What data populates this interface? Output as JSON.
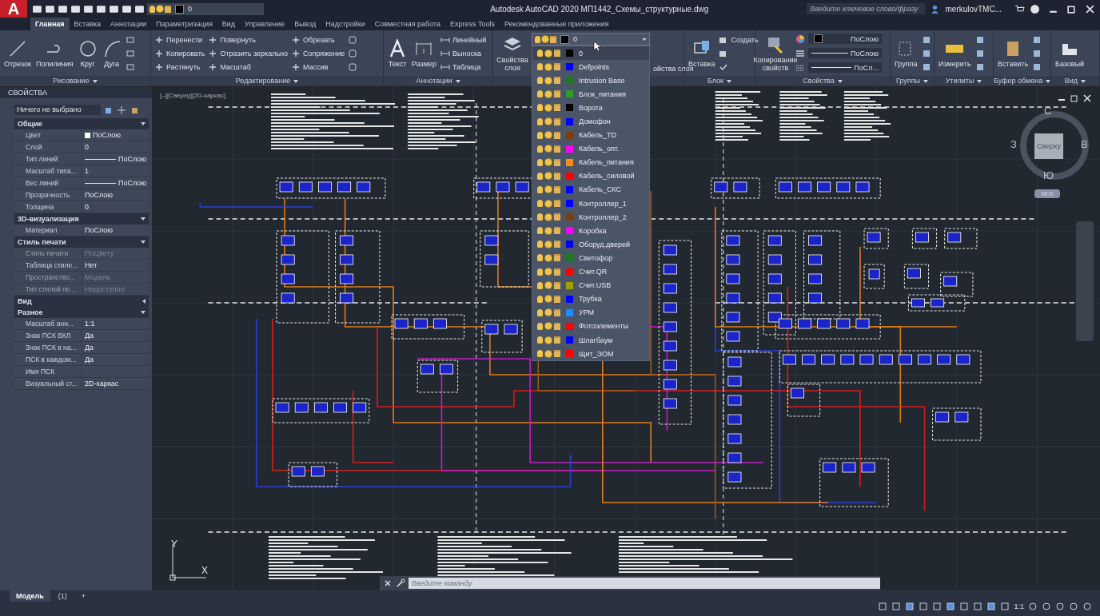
{
  "title_bar": {
    "app_button": "A",
    "layer_value": "0",
    "title": "Autodesk AutoCAD 2020  МП1442_Схемы_структурные.dwg",
    "search_placeholder": "Введите ключевое слово/фразу",
    "user": "merkulovTMC..."
  },
  "tabs": [
    {
      "label": "Главная",
      "selected": true
    },
    {
      "label": "Вставка",
      "selected": false
    },
    {
      "label": "Аннотации",
      "selected": false
    },
    {
      "label": "Параметризация",
      "selected": false
    },
    {
      "label": "Вид",
      "selected": false
    },
    {
      "label": "Управление",
      "selected": false
    },
    {
      "label": "Вывод",
      "selected": false
    },
    {
      "label": "Надстройки",
      "selected": false
    },
    {
      "label": "Совместная работа",
      "selected": false
    },
    {
      "label": "Express Tools",
      "selected": false
    },
    {
      "label": "Рекомендованные приложения",
      "selected": false
    }
  ],
  "ribbon": [
    {
      "kind": "draw",
      "title": "Рисование",
      "large": [
        "Отрезок",
        "Полилиния",
        "Круг",
        "Дуга"
      ]
    },
    {
      "kind": "modify",
      "title": "Редактирование",
      "columns": [
        [
          "Перенести",
          "Копировать",
          "Растянуть"
        ],
        [
          "Повернуть",
          "Отразить зеркально",
          "Масштаб"
        ],
        [
          "Обрезать",
          "Сопряжение",
          "Массив"
        ]
      ]
    },
    {
      "kind": "annotate",
      "title": "Аннотации",
      "large": [
        "Текст",
        "Размер"
      ],
      "small": [
        "Линейный",
        "Выноска",
        "Таблица"
      ]
    },
    {
      "kind": "layers",
      "large": [
        "Свойства слоя"
      ],
      "combo_value": "0",
      "partial_label": "ойства слоя"
    },
    {
      "kind": "block",
      "title": "Блок",
      "large": [
        "Вставка"
      ],
      "small": [
        "Создать"
      ]
    },
    {
      "kind": "properties",
      "title": "Свойства",
      "large": [
        "Копирование свойств"
      ],
      "color_value": "ПоСлою",
      "linetype_value": "ПоСлою",
      "lineweight_value": "ПоСл..."
    },
    {
      "kind": "groups",
      "title": "Группы",
      "large": [
        "Группа"
      ]
    },
    {
      "kind": "utilities",
      "title": "Утилиты",
      "large": [
        "Измерить"
      ]
    },
    {
      "kind": "clipboard",
      "title": "Буфер обмена",
      "large": [
        "Вставить"
      ]
    },
    {
      "kind": "view",
      "title": "Вид",
      "large": [
        "Базовый"
      ]
    }
  ],
  "layer_dropdown": [
    {
      "name": "0",
      "color": "#000000",
      "selected": true
    },
    {
      "name": "Defpoints",
      "color": "#0000ff",
      "selected": false
    },
    {
      "name": "Intrusion Base",
      "color": "#1e7a1e",
      "selected": false
    },
    {
      "name": "Блок_питания",
      "color": "#2aa02a",
      "selected": false
    },
    {
      "name": "Ворота",
      "color": "#000000",
      "selected": false
    },
    {
      "name": "Домофон",
      "color": "#0000ff",
      "selected": false
    },
    {
      "name": "Кабель_TD",
      "color": "#7a3f10",
      "selected": false
    },
    {
      "name": "Кабель_опт.",
      "color": "#ff00ff",
      "selected": false
    },
    {
      "name": "Кабель_питания",
      "color": "#ff8c1a",
      "selected": false
    },
    {
      "name": "Кабель_силовой",
      "color": "#ff0000",
      "selected": false
    },
    {
      "name": "Кабель_СКС",
      "color": "#0000ff",
      "selected": false
    },
    {
      "name": "Контроллер_1",
      "color": "#0000ff",
      "selected": false
    },
    {
      "name": "Контроллер_2",
      "color": "#7a3f10",
      "selected": false
    },
    {
      "name": "Коробка",
      "color": "#ff00ff",
      "selected": false
    },
    {
      "name": "Оборуд.дверей",
      "color": "#0000ff",
      "selected": false
    },
    {
      "name": "Светофор",
      "color": "#1e7a1e",
      "selected": false
    },
    {
      "name": "Счит.QR",
      "color": "#ff0000",
      "selected": false
    },
    {
      "name": "Счит.USB",
      "color": "#a0a000",
      "selected": false
    },
    {
      "name": "Трубка",
      "color": "#0000ff",
      "selected": false
    },
    {
      "name": "УРМ",
      "color": "#1e8cff",
      "selected": false
    },
    {
      "name": "Фотоэлементы",
      "color": "#ff0000",
      "selected": false
    },
    {
      "name": "Шлагбаум",
      "color": "#0000ff",
      "selected": false
    },
    {
      "name": "Щит_ЭОМ",
      "color": "#ff0000",
      "selected": false
    }
  ],
  "properties_palette": {
    "title": "СВОЙСТВА",
    "selection": "Ничего не выбрано",
    "sections": [
      {
        "title": "Общие",
        "expanded": true,
        "rows": [
          {
            "kind": "swatch",
            "label": "Цвет",
            "value": "ПоСлою",
            "disabled": false
          },
          {
            "kind": "text",
            "label": "Слой",
            "value": "0",
            "disabled": false
          },
          {
            "kind": "line",
            "label": "Тип линий",
            "value": "ПоСлою",
            "disabled": false
          },
          {
            "kind": "text",
            "label": "Масштаб типа...",
            "value": "1",
            "disabled": false
          },
          {
            "kind": "line",
            "label": "Вес линий",
            "value": "ПоСлою",
            "disabled": false
          },
          {
            "kind": "text",
            "label": "Прозрачность",
            "value": "ПоСлою",
            "disabled": false
          },
          {
            "kind": "text",
            "label": "Толщина",
            "value": "0",
            "disabled": false
          }
        ]
      },
      {
        "title": "3D-визуализация",
        "expanded": true,
        "rows": [
          {
            "kind": "text",
            "label": "Материал",
            "value": "ПоСлою",
            "disabled": false
          }
        ]
      },
      {
        "title": "Стиль печати",
        "expanded": true,
        "rows": [
          {
            "kind": "text",
            "label": "Стиль печати",
            "value": "ПоЦвету",
            "disabled": true
          },
          {
            "kind": "text",
            "label": "Таблица стиле...",
            "value": "Нет",
            "disabled": false
          },
          {
            "kind": "text",
            "label": "Пространство...",
            "value": "Модель",
            "disabled": true
          },
          {
            "kind": "text",
            "label": "Тип стилей пе...",
            "value": "Недоступно",
            "disabled": true
          }
        ]
      },
      {
        "title": "Вид",
        "expanded": false
      },
      {
        "title": "Разное",
        "expanded": true,
        "rows": [
          {
            "kind": "text",
            "label": "Масштаб анн...",
            "value": "1:1",
            "disabled": false
          },
          {
            "kind": "text",
            "label": "Знак ПСК ВКЛ",
            "value": "Да",
            "disabled": false
          },
          {
            "kind": "text",
            "label": "Знак ПСК в на...",
            "value": "Да",
            "disabled": false
          },
          {
            "kind": "text",
            "label": "ПСК в каждом...",
            "value": "Да",
            "disabled": false
          },
          {
            "kind": "text",
            "label": "Имя ПСК",
            "disabled": false
          },
          {
            "kind": "text",
            "label": "Визуальный ст...",
            "value": "2D-каркас",
            "disabled": false
          }
        ]
      }
    ]
  },
  "viewport": {
    "label": "[–][Сверху][2D-каркас]",
    "viewcube": {
      "north": "С",
      "east": "В",
      "south": "Ю",
      "west": "З",
      "face": "Сверху",
      "ucs": "МСК"
    },
    "ucs_icon": {
      "y": "Y",
      "x": "X"
    }
  },
  "command_line": {
    "placeholder": "Введите команду"
  },
  "layout_tabs": [
    {
      "label": "Модель",
      "selected": true
    },
    {
      "label": "(1)",
      "selected": false
    },
    {
      "label": "+",
      "selected": false
    }
  ],
  "status_bar": {
    "scale": "1:1"
  }
}
